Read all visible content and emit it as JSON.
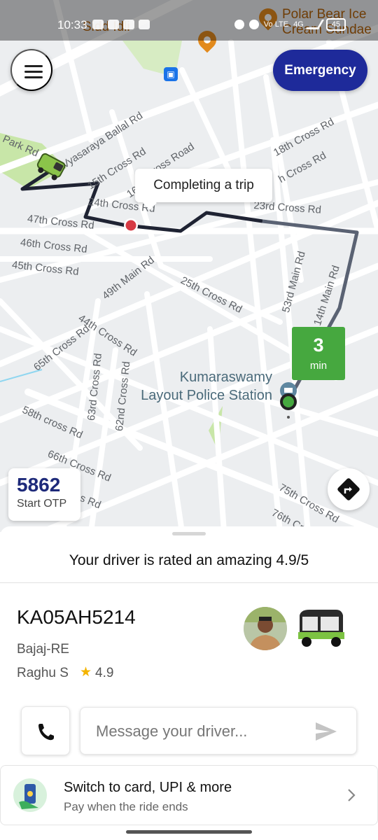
{
  "status_bar": {
    "time": "10:33",
    "network": "4G",
    "carrier_badge": "Vo LTE",
    "battery": "45"
  },
  "map": {
    "poi_left": "Idli",
    "poi_right_line1": "Polar Bear Ice",
    "poi_right_line2": "Cream Sundae",
    "poi_partial": "Sidd",
    "streets": {
      "park_rd": "Park Rd",
      "vyasaraya": "Vyasaraya Ballal Rd",
      "cross_15": "15th Cross Rd",
      "cross_road_16": "16",
      "cross_road_16b": "Cross Road",
      "cross_18": "18th Cross Rd",
      "cross_right_top": "h Cross Rd",
      "cross_24": "24th Cross Rd",
      "cross_23": "23rd Cross Rd",
      "cross_47": "47th Cross Rd",
      "cross_46": "46th Cross Rd",
      "cross_45": "45th Cross Rd",
      "main_49": "49th Main Rd",
      "cross_25": "25th Cross Rd",
      "main_53": "53rd Main Rd",
      "main_14": "14th Main Rd",
      "cross_44": "44th Cross Rd",
      "cross_65": "65th Cross Rd",
      "cross_63": "63rd Cross Rd",
      "cross_62": "62nd Cross Rd",
      "cross_58": "58th cross Rd",
      "cross_66": "66th Cross Rd",
      "cross_75": "75th Cross Rd",
      "cross_76": "76th Cro",
      "s_rd": "s Rd"
    },
    "trip_status": "Completing a trip",
    "eta_value": "3",
    "eta_unit": "min",
    "police_station_line1": "Kumaraswamy",
    "police_station_line2": "Layout Police Station",
    "colors": {
      "route_active": "#1f2333",
      "route_remaining": "#5a6273",
      "eta_green": "#46a83f",
      "park_green": "#c8e6a8"
    }
  },
  "header": {
    "menu_icon": "hamburger-menu-icon",
    "emergency_label": "Emergency",
    "emergency_color": "#1e2a9a"
  },
  "otp": {
    "code": "5862",
    "label": "Start OTP"
  },
  "sheet": {
    "rating_message": "Your driver is rated an amazing 4.9/5",
    "vehicle_number": "KA05AH5214",
    "vehicle_model": "Bajaj-RE",
    "driver_name": "Raghu S",
    "driver_rating": "4.9",
    "message_placeholder": "Message your driver...",
    "payment_title": "Switch to card, UPI & more",
    "payment_subtitle": "Pay when the ride ends"
  }
}
